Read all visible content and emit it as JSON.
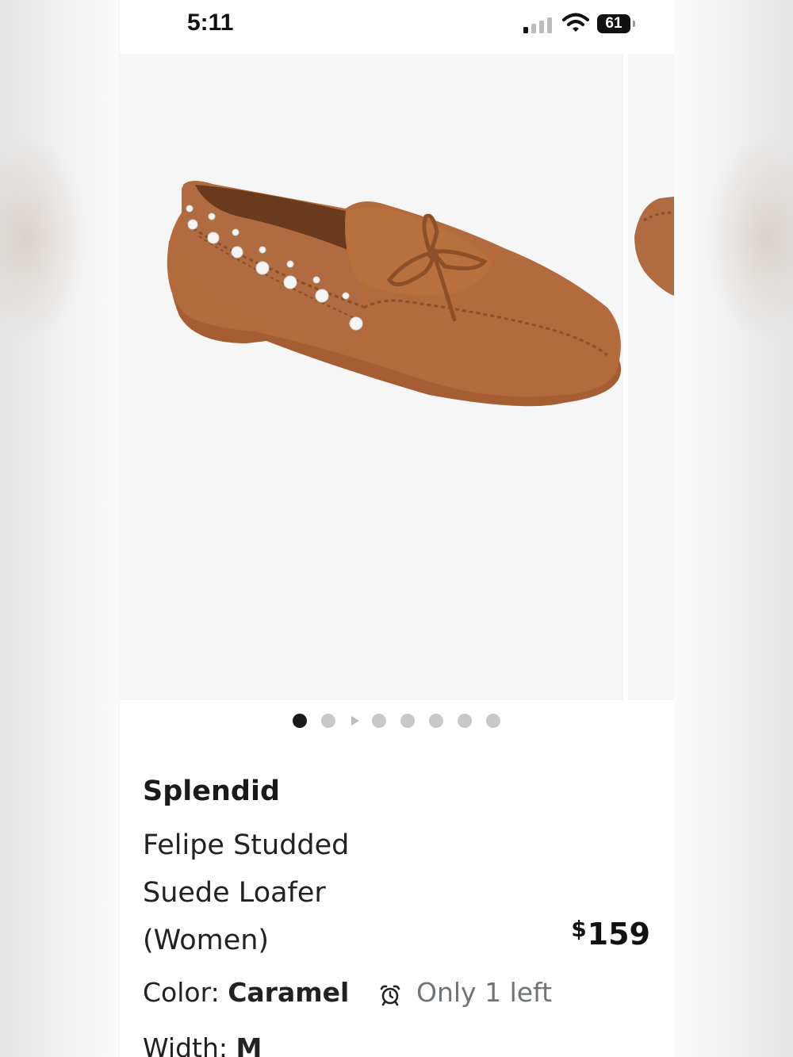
{
  "status_bar": {
    "time": "5:11",
    "battery": "61",
    "signal_bars_active": 1
  },
  "carousel": {
    "slide_count": 7,
    "active_index": 0,
    "has_video": true,
    "image_alt": "Caramel suede loafer with white studs and bow",
    "shoe_color": "#b0683a"
  },
  "product": {
    "brand": "Splendid",
    "name_lines": [
      "Felipe Studded",
      "Suede Loafer",
      "(Women)"
    ],
    "price_currency": "$",
    "price_amount": "159",
    "color_label": "Color: ",
    "color_value": "Caramel",
    "stock_text": "Only 1 left",
    "width_label": "Width: ",
    "width_value": "M"
  },
  "icons": {
    "stock": "alarm-clock-icon",
    "signal": "cellular-signal-icon",
    "wifi": "wifi-icon",
    "battery": "battery-icon"
  }
}
